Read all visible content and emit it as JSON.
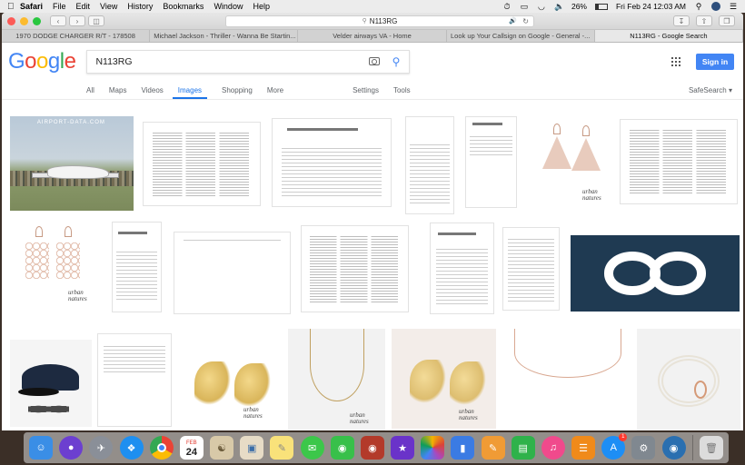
{
  "menubar": {
    "app": "Safari",
    "menus": [
      "File",
      "Edit",
      "View",
      "History",
      "Bookmarks",
      "Window",
      "Help"
    ],
    "battery": "26%",
    "datetime": "Fri Feb 24  12:03 AM"
  },
  "browser": {
    "address": "N113RG",
    "tabs": [
      {
        "label": "1970 DODGE CHARGER R/T - 178508",
        "active": false
      },
      {
        "label": "Michael Jackson - Thriller - Wanna Be Startin...",
        "active": false
      },
      {
        "label": "Velder airways VA - Home",
        "active": false
      },
      {
        "label": "Look up Your Callsign on Google - General -...",
        "active": false
      },
      {
        "label": "N113RG - Google Search",
        "active": true
      }
    ]
  },
  "google": {
    "logo": [
      "G",
      "o",
      "o",
      "g",
      "l",
      "e"
    ],
    "query": "N113RG",
    "signin": "Sign in",
    "nav": {
      "all": "All",
      "maps": "Maps",
      "videos": "Videos",
      "images": "Images",
      "shopping": "Shopping",
      "more": "More",
      "settings": "Settings",
      "tools": "Tools",
      "safesearch": "SafeSearch ▾"
    },
    "image_results": {
      "watermark": "AIRPORT-DATA.COM",
      "brand": [
        "urban",
        "natures"
      ]
    }
  },
  "dock": {
    "calendar_month": "FEB",
    "calendar_day": "24",
    "appstore_badge": "1",
    "colors": {
      "finder": "#3a8ee6",
      "siri": "#6c3fd0",
      "launchpad": "#8a8f98",
      "safari": "#1e8ff0",
      "chrome": "#ffffff",
      "calendar": "#ffffff",
      "contacts": "#d8c9a8",
      "preview": "#e7dcc6",
      "notes": "#f9e27a",
      "messages": "#3cc74a",
      "facetime": "#38c04a",
      "photobooth": "#b33a2a",
      "imovie": "#6a33c9",
      "photos": "#ffffff",
      "keynote": "#3b7be3",
      "pages": "#f09b35",
      "numbers": "#2fb24b",
      "itunes": "#f04a8c",
      "ibooks": "#f08a1a",
      "appstore": "#1d8ef5",
      "prefs": "#808890",
      "earth": "#2a6fb0",
      "trash": "#dcdcdc"
    }
  }
}
